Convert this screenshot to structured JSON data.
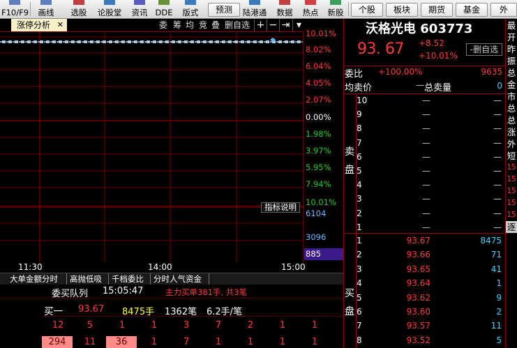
{
  "toolbar": {
    "left_top": "F10/F9",
    "buttons": [
      "画线",
      "选股",
      "论股堂",
      "资讯",
      "DDE",
      "版式",
      "预测",
      "陆港通",
      "数据",
      "热点",
      "新股"
    ],
    "right_buttons": [
      "个股",
      "板块",
      "期货",
      "基金",
      "外"
    ]
  },
  "chart": {
    "tab_label": "涨停分析",
    "tab_close": "✕",
    "tools": [
      "委",
      "筹",
      "均",
      "竞",
      "叠",
      "删自选"
    ],
    "tool_icons": [
      "+",
      "−",
      "⇥",
      "▾"
    ],
    "pct_up": [
      "10.01%",
      "8.02%",
      "6.04%",
      "4.05%",
      "2.07%"
    ],
    "pct_zero": "0.00%",
    "pct_down": [
      "1.98%",
      "3.97%",
      "5.95%",
      "7.94%",
      "10.01%"
    ],
    "indicator_label": "指标说明",
    "volume_labels": [
      "6104",
      "3096",
      "885"
    ],
    "x_times": [
      "11:30",
      "14:00",
      "15:00"
    ],
    "colors": {
      "up": "#ff3a3a",
      "down": "#22cc22",
      "grid": "#6b0000",
      "line": "#6ab0d8"
    }
  },
  "chart_data": {
    "type": "line",
    "y_left_labels": [
      "10.01%",
      "8.02%",
      "6.04%",
      "4.05%",
      "2.07%",
      "0.00%",
      "1.98%",
      "3.97%",
      "5.95%",
      "7.94%",
      "10.01%"
    ],
    "x_ticks": [
      "11:30",
      "14:00",
      "15:00"
    ],
    "price_line_pct": 10.01,
    "volume_ticks": [
      6104,
      3096,
      885
    ]
  },
  "subtabs": [
    "大单金额分时",
    "高抛低吸",
    "千档委比",
    "分时人气资金"
  ],
  "queue": {
    "title": "委买队列",
    "time": "15:05:47",
    "summary": "主力买单381手, 共3笔",
    "buy1_label": "买一",
    "buy1_price": "93.67",
    "buy1_volume": "8475手",
    "buy1_count": "1362笔",
    "buy1_avg": "6.2手/笔",
    "row1": [
      "12",
      "5",
      "1",
      "1",
      "3",
      "7",
      "2",
      "1",
      "1"
    ],
    "row2": [
      "294",
      "11",
      "36",
      "1",
      "7",
      "1",
      "1",
      "1",
      "1"
    ]
  },
  "stock": {
    "name_code": "沃格光电 603773",
    "price": "93. 67",
    "change": "+8.52",
    "change_pct": "+10.01%",
    "remove_btn": "-删自选",
    "ratio_label": "委比",
    "ratio_value": "+100.00%",
    "ratio_diff": "9635",
    "avg_label": "均卖价",
    "avg_value": "—",
    "total_label": "总卖量",
    "total_value": "0",
    "sell_side": "卖\n盘",
    "buy_side": "买\n盘",
    "sell_rows": [
      {
        "level": "10",
        "price": "—",
        "vol": "—"
      },
      {
        "level": "9",
        "price": "—",
        "vol": "—"
      },
      {
        "level": "8",
        "price": "—",
        "vol": "—"
      },
      {
        "level": "7",
        "price": "—",
        "vol": "—"
      },
      {
        "level": "6",
        "price": "—",
        "vol": "—"
      },
      {
        "level": "5",
        "price": "—",
        "vol": "—"
      },
      {
        "level": "4",
        "price": "—",
        "vol": "—"
      },
      {
        "level": "3",
        "price": "—",
        "vol": "—"
      },
      {
        "level": "2",
        "price": "—",
        "vol": "—"
      },
      {
        "level": "1",
        "price": "—",
        "vol": "—"
      }
    ],
    "buy_rows": [
      {
        "level": "1",
        "price": "93.67",
        "vol": "8475"
      },
      {
        "level": "2",
        "price": "93.66",
        "vol": "71"
      },
      {
        "level": "3",
        "price": "93.65",
        "vol": "41"
      },
      {
        "level": "4",
        "price": "93.64",
        "vol": "1"
      },
      {
        "level": "5",
        "price": "93.62",
        "vol": "9"
      },
      {
        "level": "6",
        "price": "93.60",
        "vol": "2"
      },
      {
        "level": "7",
        "price": "93.57",
        "vol": "11"
      },
      {
        "level": "8",
        "price": "93.52",
        "vol": "5"
      }
    ]
  },
  "far_right": [
    "最",
    "开",
    "昨",
    "振",
    "总",
    "金",
    "市",
    "总",
    "总",
    "涨",
    "外",
    "短",
    "15",
    "15",
    "15",
    "15",
    "15",
    "逐"
  ]
}
